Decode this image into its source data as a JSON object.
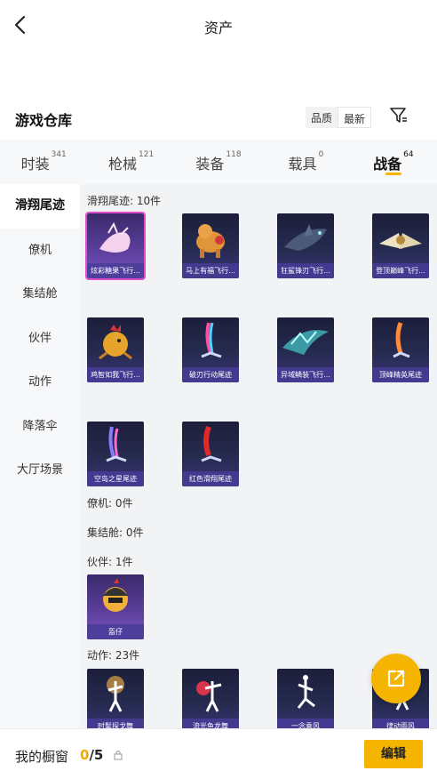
{
  "header": {
    "title": "资产"
  },
  "section": {
    "title": "游戏仓库",
    "sort_quality": "品质",
    "sort_latest": "最新"
  },
  "tabs": [
    {
      "label": "时装",
      "count": "341"
    },
    {
      "label": "枪械",
      "count": "121"
    },
    {
      "label": "装备",
      "count": "118"
    },
    {
      "label": "载具",
      "count": "0"
    },
    {
      "label": "战备",
      "count": "64"
    }
  ],
  "sidebar": {
    "items": [
      {
        "label": "滑翔尾迹"
      },
      {
        "label": "僚机"
      },
      {
        "label": "集结舱"
      },
      {
        "label": "伙伴"
      },
      {
        "label": "动作"
      },
      {
        "label": "降落伞"
      },
      {
        "label": "大厅场景"
      }
    ]
  },
  "categories": [
    {
      "label": "滑翔尾迹: 10件"
    },
    {
      "label": "僚机: 0件"
    },
    {
      "label": "集结舱: 0件"
    },
    {
      "label": "伙伴: 1件"
    },
    {
      "label": "动作: 23件"
    }
  ],
  "items": [
    {
      "name": "炫彩糖果飞行..."
    },
    {
      "name": "马上有福飞行..."
    },
    {
      "name": "狂鲨锋刃飞行..."
    },
    {
      "name": "登顶巅峰飞行..."
    },
    {
      "name": "鸡智如我飞行..."
    },
    {
      "name": "破刃行动尾迹"
    },
    {
      "name": "异域鳞装飞行..."
    },
    {
      "name": "顶峰精英尾迹"
    },
    {
      "name": "空岛之星尾迹"
    },
    {
      "name": "红色滑翔尾迹"
    },
    {
      "name": "盔仔"
    },
    {
      "name": "时髦探戈舞"
    },
    {
      "name": "流光鱼龙舞"
    },
    {
      "name": "一念乘风"
    },
    {
      "name": "律动雨风"
    }
  ],
  "showcase": {
    "label": "我的橱窗",
    "current": "0",
    "total": "/5",
    "edit_label": "编辑"
  },
  "colors": {
    "accent": "#f5b400",
    "rare_outline": "#e04fc8"
  },
  "icons": {
    "back": "chevron-left-icon",
    "filter": "filter-icon",
    "share": "external-link-icon",
    "lock": "lock-icon"
  }
}
